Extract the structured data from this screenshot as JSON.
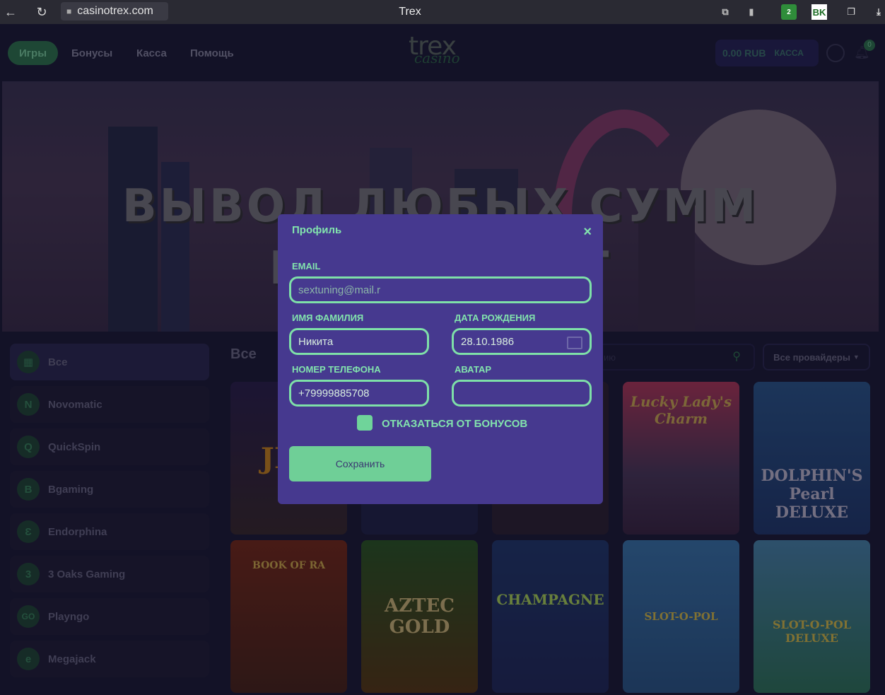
{
  "browser": {
    "url": "casinotrex.com",
    "tab_title": "Trex",
    "ext_badge": "2",
    "ext_vk": "BK"
  },
  "nav": {
    "items": [
      {
        "label": "Игры",
        "active": true
      },
      {
        "label": "Бонусы"
      },
      {
        "label": "Касса"
      },
      {
        "label": "Помощь"
      }
    ],
    "logo_top": "trex",
    "logo_bottom": "casino",
    "balance": "0.00 RUB",
    "kassa_label": "КАССА",
    "notif_count": "0"
  },
  "banner": {
    "line1": "ВЫВОД ЛЮБЫХ СУММ",
    "line2": "В ТЕ      МИНУТ"
  },
  "sidebar": {
    "items": [
      {
        "label": "Все",
        "icon": "grid-icon",
        "glyph": "▦"
      },
      {
        "label": "Novomatic",
        "icon": "novomatic-icon",
        "glyph": "N"
      },
      {
        "label": "QuickSpin",
        "icon": "quickspin-icon",
        "glyph": "Q"
      },
      {
        "label": "Bgaming",
        "icon": "bgaming-icon",
        "glyph": "B"
      },
      {
        "label": "Endorphina",
        "icon": "endorphina-icon",
        "glyph": "Ɛ"
      },
      {
        "label": "3 Oaks Gaming",
        "icon": "3oaks-icon",
        "glyph": "3"
      },
      {
        "label": "Playngo",
        "icon": "playngo-icon",
        "glyph": "GO"
      },
      {
        "label": "Megajack",
        "icon": "megajack-icon",
        "glyph": "e"
      }
    ]
  },
  "main": {
    "title": "Все",
    "search_placeholder": "ию",
    "provider_label": "Все провайдеры"
  },
  "games": {
    "row1": [
      "JET",
      "",
      "",
      "Lucky Lady's Charm",
      "DOLPHIN'S Pearl DELUXE"
    ],
    "row2": [
      "BOOK OF RA",
      "AZTEC GOLD",
      "CHAMPAGNE",
      "SLOT-O-POL",
      "SLOT-O-POL DELUXE"
    ]
  },
  "modal": {
    "title": "Профиль",
    "close": "×",
    "email_label": "EMAIL",
    "email_value": "sextuning@mail.r",
    "name_label": "ИМЯ ФАМИЛИЯ",
    "name_value": "Никита",
    "birth_label": "ДАТА РОЖДЕНИЯ",
    "birth_value": "28.10.1986",
    "phone_label": "НОМЕР ТЕЛЕФОНА",
    "phone_value": "+79999885708",
    "avatar_label": "АВАТАР",
    "avatar_value": "",
    "bonus_label": "ОТКАЗАТЬСЯ ОТ БОНУСОВ",
    "save_label": "Сохранить"
  },
  "colors": {
    "modal_bg": "#46398f",
    "accent": "#7ee0a8",
    "page_bg": "#1b1a33"
  }
}
